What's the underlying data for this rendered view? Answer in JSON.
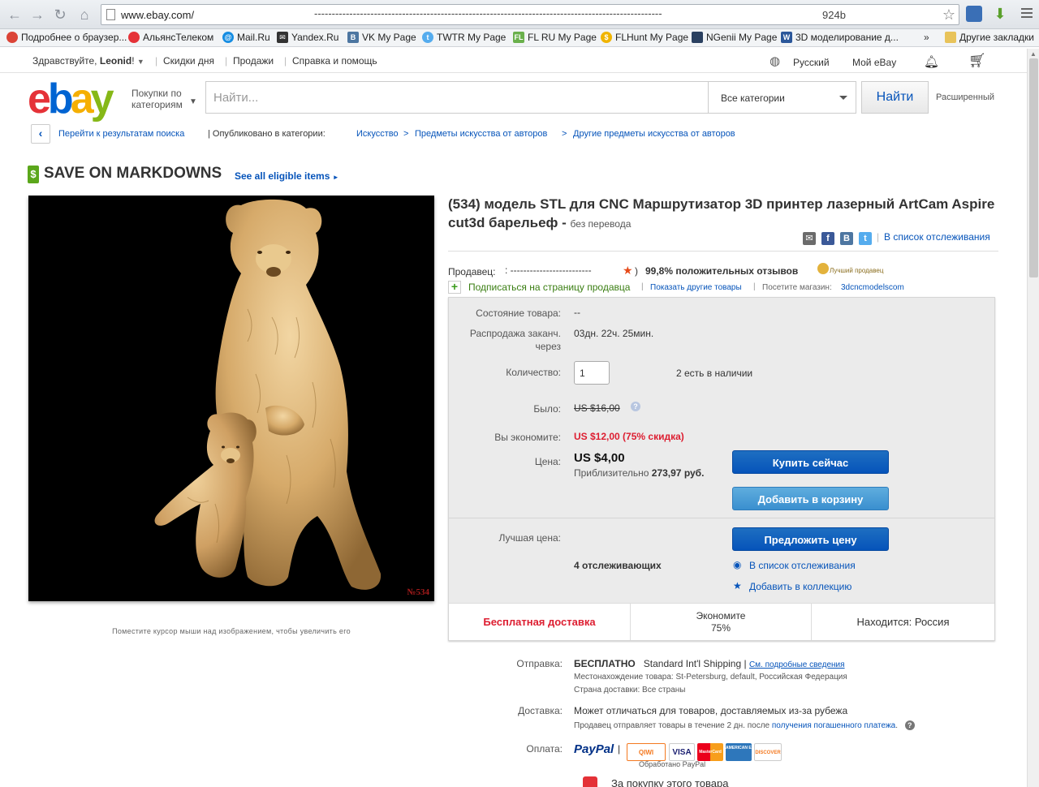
{
  "browser": {
    "url": "www.ebay.com/",
    "url_masked": "---------------------------------------------------------------------------------------------------",
    "url_suffix": "924b",
    "bookmarks": [
      {
        "label": "Подробнее о браузер...",
        "icon": "chrome-icon",
        "color": "#db4437"
      },
      {
        "label": "АльянсТелеком",
        "icon": "alliance-icon",
        "color": "#e53238"
      },
      {
        "label": "Mail.Ru",
        "icon": "mailru-icon",
        "color": "#168de2"
      },
      {
        "label": "Yandex.Ru",
        "icon": "mail-icon",
        "color": "#333333"
      },
      {
        "label": "VK My Page",
        "icon": "vk-icon",
        "color": "#4d76a1"
      },
      {
        "label": "TWTR My Page",
        "icon": "twitter-icon",
        "color": "#55acee"
      },
      {
        "label": "FL RU My Page",
        "icon": "fl-icon",
        "color": "#6ab04c"
      },
      {
        "label": "FLHunt My Page",
        "icon": "flhunt-icon",
        "color": "#f0b400"
      },
      {
        "label": "NGenii My Page",
        "icon": "ngenii-icon",
        "color": "#2a4060"
      },
      {
        "label": "3D моделирование д...",
        "icon": "word-icon",
        "color": "#2b579a"
      }
    ],
    "other_bookmarks": "Другие закладки"
  },
  "topnav": {
    "greeting": "Здравствуйте, ",
    "user": "Leonid",
    "greeting_end": "!",
    "deals": "Скидки дня",
    "sell": "Продажи",
    "help": "Справка и помощь",
    "language": "Русский",
    "my_ebay": "Мой eBay"
  },
  "header": {
    "logo_letters": [
      "e",
      "b",
      "a",
      "y"
    ],
    "shop_by_line1": "Покупки по",
    "shop_by_line2": "категориям",
    "search_placeholder": "Найти...",
    "category": "Все категории",
    "search_button": "Найти",
    "advanced": "Расширенный"
  },
  "breadcrumbs": {
    "back": "Перейти к результатам поиска",
    "listed_in": "| Опубликовано в категории:",
    "items": [
      "Искусство",
      "Предметы искусства от авторов",
      "Другие предметы искусства от авторов"
    ],
    "sep": ">"
  },
  "promo": {
    "title": "SAVE ON MARKDOWNS",
    "link": "See all eligible items",
    "arrow": "►",
    "tag_symbol": "$"
  },
  "image": {
    "stamp": "№534",
    "caption": "Поместите курсор мыши над изображением, чтобы увеличить его"
  },
  "item": {
    "title": "(534) модель STL для CNC Маршрутизатор 3D принтер лазерный ArtCam Aspire cut3d барельеф - ",
    "no_translation": "без перевода",
    "watch_link": "В список отслеживания"
  },
  "seller": {
    "label": "Продавец:",
    "name_masked": ": -------------------------",
    "score_open": ")",
    "feedback": "99,8% положительных отзывов",
    "top_seller": "Лучший продавец",
    "follow": "Подписаться на страницу продавца",
    "other_items": "Показать другие товары",
    "visit_store": "Посетите магазин:",
    "store_name": "3dcncmodelscom"
  },
  "buybox": {
    "condition_label": "Состояние товара:",
    "condition_value": "--",
    "ends_label_1": "Распродажа заканч.",
    "ends_label_2": "через",
    "ends_value": "03дн. 22ч. 25мин.",
    "qty_label": "Количество:",
    "qty_value": "1",
    "available": "2 есть в наличии",
    "was_label": "Было:",
    "was_value": "US $16,00",
    "save_label": "Вы экономите:",
    "save_value": "US $12,00 (75% скидка)",
    "price_label": "Цена:",
    "price_value": "US $4,00",
    "approx_prefix": "Приблизительно ",
    "approx_value": "273,97 руб.",
    "buy_now": "Купить сейчас",
    "add_to_cart": "Добавить в корзину",
    "best_offer_label": "Лучшая цена:",
    "make_offer": "Предложить цену",
    "watchers": "4 отслеживающих",
    "add_watch": "В список отслеживания",
    "add_collection": "Добавить в коллекцию",
    "free_shipping": "Бесплатная доставка",
    "save_cell_1": "Экономите",
    "save_cell_2": "75%",
    "location": "Находится: Россия"
  },
  "shipping": {
    "ship_label": "Отправка:",
    "ship_free": "БЕСПЛАТНО",
    "ship_method": "Standard Int'l Shipping",
    "ship_bar": "|",
    "ship_details": "См. подробные сведения",
    "item_location": "Местонахождение товара:  St-Petersburg, default, Российская Федерация",
    "ships_to": "Страна доставки:  Все страны",
    "delivery_label": "Доставка:",
    "delivery_text": "Может отличаться для товаров, доставляемых из-за рубежа",
    "handling": "Продавец отправляет товары в течение 2 дн. после ",
    "handling_link": "получения погашенного платежа",
    "handling_dot": ".",
    "payment_label": "Оплата:",
    "paypal": "PayPal",
    "processed": "Обработано PayPal",
    "payment_icons": [
      "QIWI",
      "VISA",
      "MasterCard",
      "AMERICAN EXPRESS",
      "DISCOVER"
    ],
    "guarantee": "За покупку этого товара"
  },
  "colors": {
    "link": "#0654ba",
    "red": "#dd1e31",
    "green": "#3a7e12"
  }
}
